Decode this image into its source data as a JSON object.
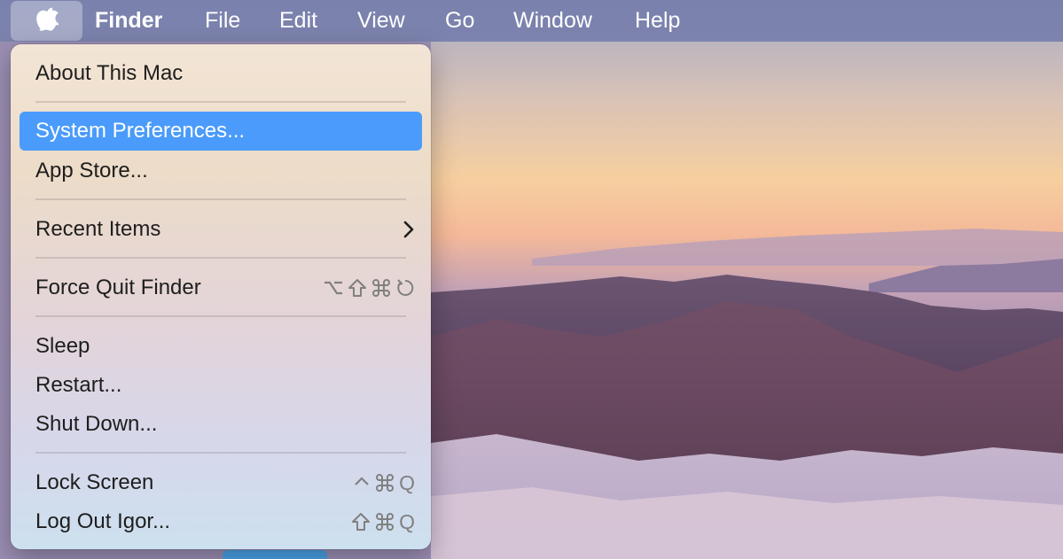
{
  "menubar": {
    "apple_icon": "apple-icon",
    "app_name": "Finder",
    "items": [
      "File",
      "Edit",
      "View",
      "Go",
      "Window",
      "Help"
    ]
  },
  "apple_menu": {
    "items": [
      {
        "label": "About This Mac"
      },
      {
        "label": "System Preferences...",
        "highlighted": true
      },
      {
        "label": "App Store..."
      },
      {
        "label": "Recent Items",
        "submenu": true
      },
      {
        "label": "Force Quit Finder",
        "shortcut": [
          "option-icon",
          "shift-icon",
          "command-icon",
          "force-quit-icon"
        ]
      },
      {
        "label": "Sleep"
      },
      {
        "label": "Restart..."
      },
      {
        "label": "Shut Down..."
      },
      {
        "label": "Lock Screen",
        "shortcut": [
          "control-icon",
          "command-icon",
          "Q"
        ]
      },
      {
        "label": "Log Out Igor...",
        "shortcut": [
          "shift-icon",
          "command-icon",
          "Q"
        ]
      }
    ],
    "shortcut_q": "Q"
  },
  "colors": {
    "highlight": "#4a9bfb",
    "menubar": "#7c83ad"
  }
}
